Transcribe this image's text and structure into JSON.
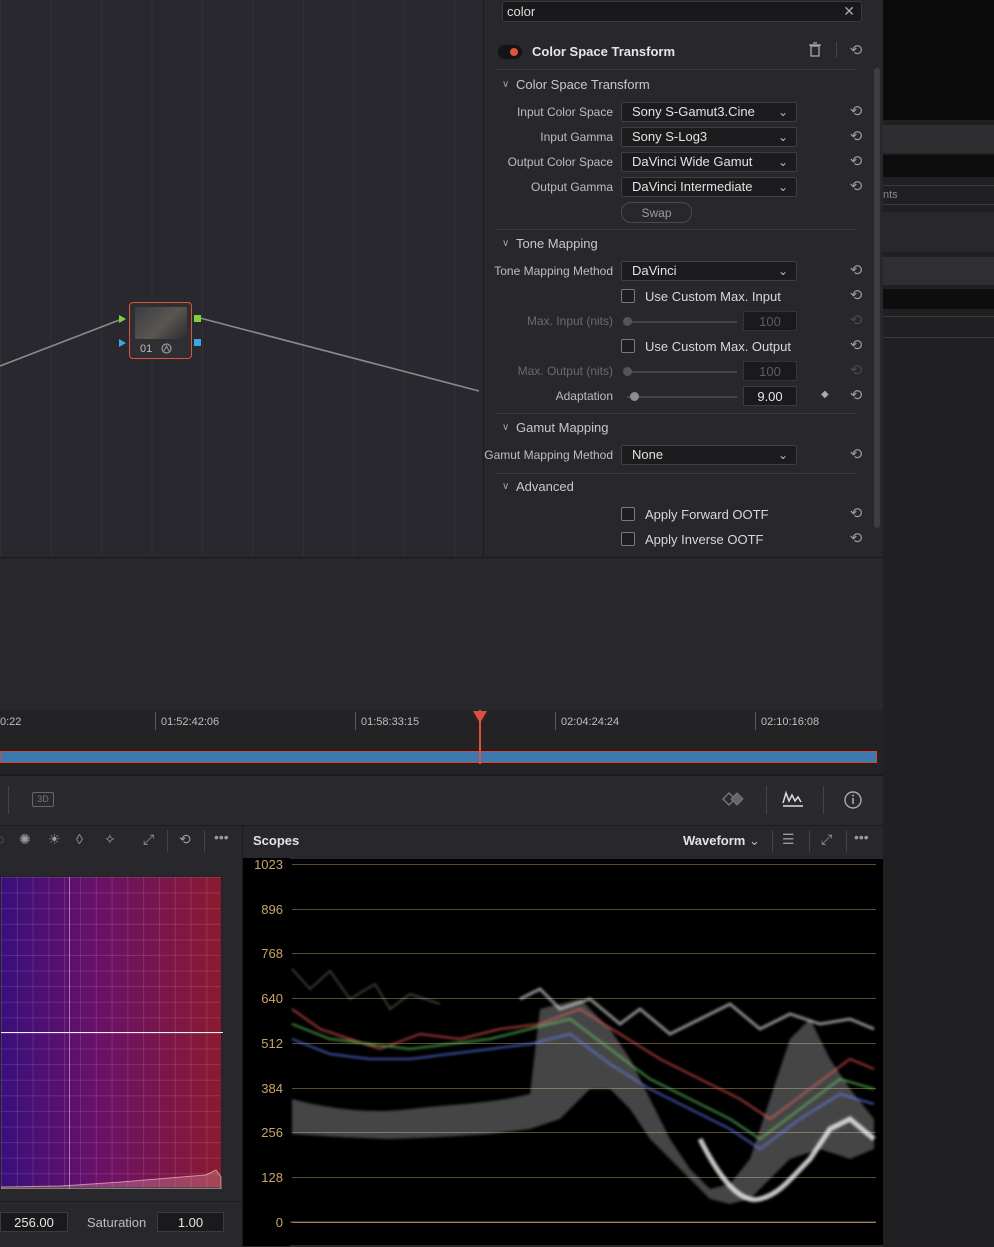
{
  "search": {
    "value": "color"
  },
  "node": {
    "label": "01"
  },
  "panel": {
    "title": "Color Space Transform",
    "csp_section": "Color Space Transform",
    "rows": {
      "input_color_space": {
        "label": "Input Color Space",
        "value": "Sony S-Gamut3.Cine"
      },
      "input_gamma": {
        "label": "Input Gamma",
        "value": "Sony S-Log3"
      },
      "output_color_space": {
        "label": "Output Color Space",
        "value": "DaVinci Wide Gamut"
      },
      "output_gamma": {
        "label": "Output Gamma",
        "value": "DaVinci Intermediate"
      }
    },
    "swap_label": "Swap",
    "tone_section": "Tone Mapping",
    "tone_method": {
      "label": "Tone Mapping Method",
      "value": "DaVinci"
    },
    "custom_max_input": "Use Custom Max. Input",
    "max_input": {
      "label": "Max. Input (nits)",
      "value": "100"
    },
    "custom_max_output": "Use Custom Max. Output",
    "max_output": {
      "label": "Max. Output (nits)",
      "value": "100"
    },
    "adaptation": {
      "label": "Adaptation",
      "value": "9.00"
    },
    "gamut_section": "Gamut Mapping",
    "gamut_method": {
      "label": "Gamut Mapping Method",
      "value": "None"
    },
    "advanced_section": "Advanced",
    "fwd_ootf": "Apply Forward OOTF",
    "inv_ootf": "Apply Inverse OOTF"
  },
  "edge": {
    "text": "nts"
  },
  "timeline": {
    "codes": [
      "0:22",
      "01:52:42:06",
      "01:58:33:15",
      "02:04:24:24",
      "02:10:16:08"
    ]
  },
  "toolbar": {
    "btn_3d": "3D"
  },
  "curves": {
    "value_box": "256.00",
    "saturation_label": "Saturation",
    "saturation_value": "1.00"
  },
  "scopes": {
    "title": "Scopes",
    "mode": "Waveform",
    "y_labels": [
      "1023",
      "896",
      "768",
      "640",
      "512",
      "384",
      "256",
      "128",
      "0"
    ]
  },
  "colors": {
    "accent_red": "#e0533d",
    "playhead": "#e04f3c",
    "scope_label": "#c9a46a"
  }
}
